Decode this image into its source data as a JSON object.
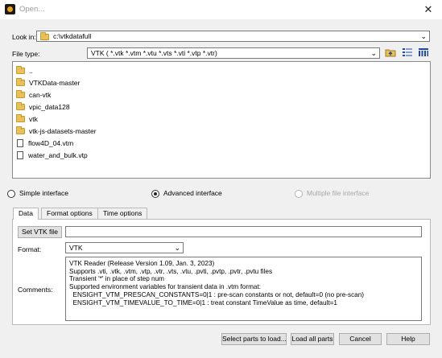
{
  "window": {
    "title": "Open..."
  },
  "look_in": {
    "label": "Look in:",
    "path": "c:\\vtkdatafull"
  },
  "file_type": {
    "label": "File type:",
    "value": "VTK ( *.vtk *.vtm *.vtu *.vts *.vti *.vtp *.vtr)"
  },
  "toolbar_icons": [
    "up-folder-icon",
    "list-view-icon",
    "detail-view-icon"
  ],
  "files": [
    {
      "name": "..",
      "kind": "folder"
    },
    {
      "name": "VTKData-master",
      "kind": "folder"
    },
    {
      "name": "can-vtk",
      "kind": "folder"
    },
    {
      "name": "vpic_data128",
      "kind": "folder"
    },
    {
      "name": "vtk",
      "kind": "folder"
    },
    {
      "name": "vtk-js-datasets-master",
      "kind": "folder"
    },
    {
      "name": "flow4D_04.vtm",
      "kind": "file"
    },
    {
      "name": "water_and_bulk.vtp",
      "kind": "file"
    }
  ],
  "interface": {
    "simple": "Simple interface",
    "advanced": "Advanced interface",
    "multiple": "Multiple file interface",
    "selected": "advanced"
  },
  "tabs": [
    "Data",
    "Format options",
    "Time options"
  ],
  "data_tab": {
    "set_file_button": "Set VTK file",
    "file_value": "",
    "format_label": "Format:",
    "format_value": "VTK",
    "comments_label": "Comments:",
    "comments": [
      "VTK Reader (Release Version 1.09, Jan. 3, 2023)",
      "Supports .vti, .vtk, .vtm, .vtp, .vtr, .vts, .vtu, .pvti, .pvtp, .pvtr, .pvtu files",
      "Transient '*' in place of step num",
      "Supported environment variables for transient data in .vtm format:",
      "  ENSIGHT_VTM_PRESCAN_CONSTANTS=0|1 : pre-scan constants or not, default=0 (no pre-scan)",
      "  ENSIGHT_VTM_TIMEVALUE_TO_TIME=0|1 : treat constant TimeValue as time, default=1"
    ]
  },
  "buttons": {
    "select_parts": "Select parts to load...",
    "load_all": "Load all parts",
    "cancel": "Cancel",
    "help": "Help"
  }
}
